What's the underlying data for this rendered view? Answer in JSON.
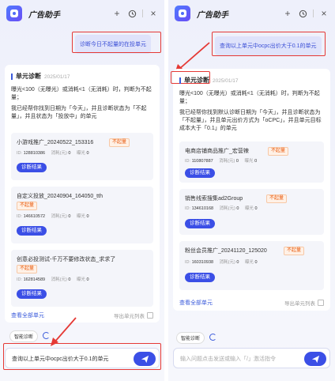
{
  "left": {
    "app_title": "广告助手",
    "user_message": "诊断今日不起量的在投单元",
    "card": {
      "title": "单元诊断",
      "date": "2025/01/17",
      "criteria": "曝光<100（无曝光）或消耗<1（无消耗）时，判断为不起量；",
      "summary": "我已经帮你找到日期为「今天」，并且诊断状态为「不起量」，并且状态为「投放中」的单元",
      "items": [
        {
          "name": "小游戏推广_20240522_153316",
          "tag": "不起量",
          "id_label": "ID:",
          "id": "128810386",
          "cost_label": "消耗(元)",
          "cost": "0",
          "exp_label": "曝光",
          "exp": "0",
          "button": "诊断结果"
        },
        {
          "name": "自定义投放_20240904_164050_tth",
          "tag": "不起量",
          "id_label": "ID:",
          "id": "146610572",
          "cost_label": "消耗(元)",
          "cost": "0",
          "exp_label": "曝光",
          "exp": "0",
          "button": "诊断结果"
        },
        {
          "name": "创意必投测试-千万不要修改状态_求求了",
          "tag": "不起量",
          "id_label": "ID:",
          "id": "162814589",
          "cost_label": "消耗(元)",
          "cost": "0",
          "exp_label": "曝光",
          "exp": "0",
          "button": "诊断结果"
        }
      ],
      "view_all": "查看全部单元",
      "export": "导出单元列表"
    },
    "chip": "智能诊断",
    "input_value": "查询以上单元中ocpc出价大于0.1的单元"
  },
  "right": {
    "app_title": "广告助手",
    "user_message": "查询以上单元中ocpc出价大于0.1的单元",
    "card": {
      "title": "单元诊断",
      "date": "2025/01/17",
      "criteria": "曝光<100（无曝光）或消耗<1（无消耗）时，判断为不起量；",
      "summary": "我已经帮你找到默认诊断日期为「今天」，并且诊断状态为「不起量」，并且单元出价方式为「oCPC」，并且单元目标成本大于「0.1」的单元",
      "items": [
        {
          "name": "电商店铺商品推广_宏营辣",
          "tag": "不起量",
          "id_label": "ID:",
          "id": "110807887",
          "cost_label": "消耗(元)",
          "cost": "0",
          "exp_label": "曝光",
          "exp": "0",
          "button": "诊断结果"
        },
        {
          "name": "销售线索搜集ad2Group",
          "tag": "不起量",
          "id_label": "ID:",
          "id": "134610168",
          "cost_label": "消耗(元)",
          "cost": "0",
          "exp_label": "曝光",
          "exp": "0",
          "button": "诊断结果"
        },
        {
          "name": "粉丝会员推广_20241120_125020",
          "tag": "不起量",
          "id_label": "ID:",
          "id": "160310938",
          "cost_label": "消耗(元)",
          "cost": "0",
          "exp_label": "曝光",
          "exp": "0",
          "button": "诊断结果"
        }
      ],
      "view_all": "查看全部单元",
      "export": "导出单元列表"
    },
    "chip": "智能诊断",
    "input_placeholder": "输入问题点击发送或输入「/」激活指令"
  },
  "colors": {
    "accent": "#3b4fe6",
    "highlight": "#e53935",
    "tag": "#e8590c"
  },
  "icons": [
    "app-logo-icon",
    "plus-icon",
    "history-icon",
    "close-icon",
    "refresh-icon",
    "export-icon",
    "send-icon",
    "annotation-arrow"
  ]
}
